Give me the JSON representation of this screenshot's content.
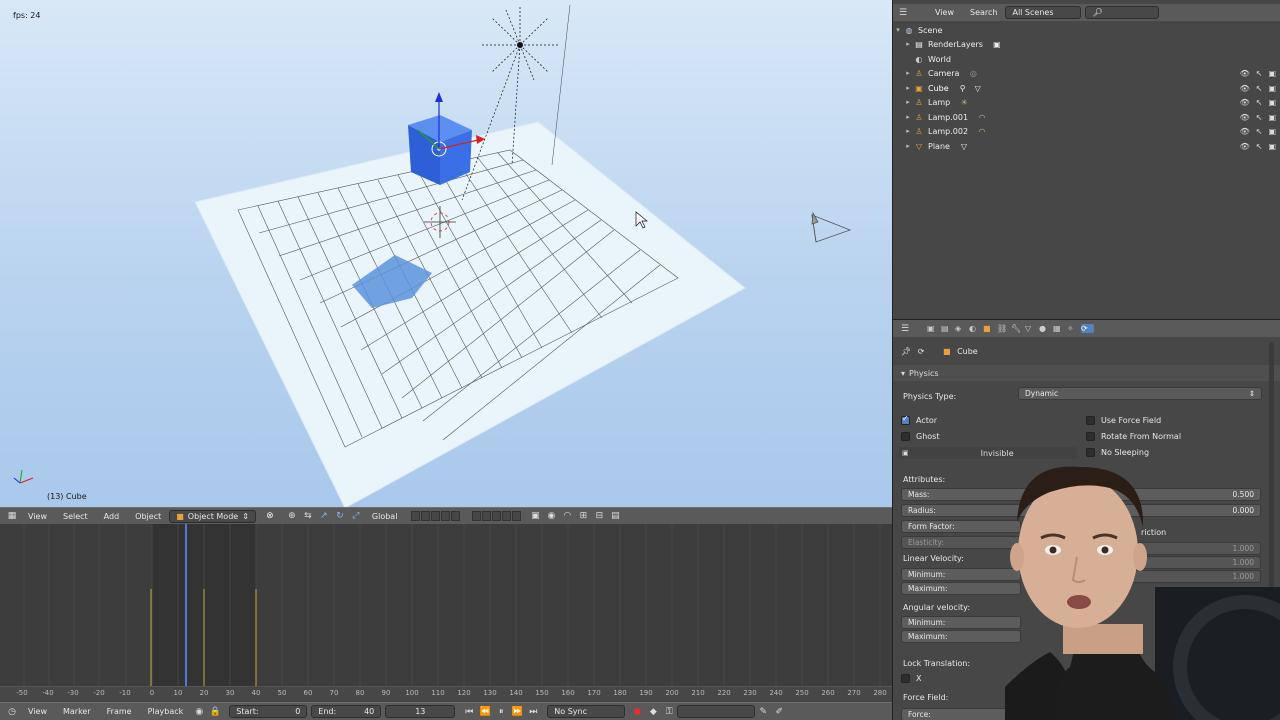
{
  "viewport": {
    "fps": "fps: 24",
    "object_label": "(13) Cube"
  },
  "view3d_header": {
    "menu_view": "View",
    "menu_select": "Select",
    "menu_add": "Add",
    "menu_object": "Object",
    "mode": "Object Mode",
    "orientation": "Global"
  },
  "timeline_header": {
    "menu_view": "View",
    "menu_marker": "Marker",
    "menu_frame": "Frame",
    "menu_playback": "Playback",
    "start_label": "Start:",
    "start_value": "0",
    "end_label": "End:",
    "end_value": "40",
    "current_frame": "13",
    "sync": "No Sync"
  },
  "ruler_ticks": [
    "-50",
    "-40",
    "-30",
    "-20",
    "-10",
    "0",
    "10",
    "20",
    "30",
    "40",
    "50",
    "60",
    "70",
    "80",
    "90",
    "100",
    "110",
    "120",
    "130",
    "140",
    "150",
    "160",
    "170",
    "180",
    "190",
    "200",
    "210",
    "220",
    "230",
    "240",
    "250",
    "260",
    "270",
    "280"
  ],
  "outliner": {
    "menu_view": "View",
    "menu_search": "Search",
    "scenes_dropdown": "All Scenes",
    "items": [
      {
        "label": "Scene",
        "indent": 0
      },
      {
        "label": "RenderLayers",
        "indent": 1
      },
      {
        "label": "World",
        "indent": 1
      },
      {
        "label": "Camera",
        "indent": 1
      },
      {
        "label": "Cube",
        "indent": 1
      },
      {
        "label": "Lamp",
        "indent": 1
      },
      {
        "label": "Lamp.001",
        "indent": 1
      },
      {
        "label": "Lamp.002",
        "indent": 1
      },
      {
        "label": "Plane",
        "indent": 1
      }
    ]
  },
  "properties": {
    "context_object": "Cube",
    "section_physics": "Physics",
    "physics_type_label": "Physics Type:",
    "physics_type_value": "Dynamic",
    "actor": "Actor",
    "ghost": "Ghost",
    "invisible": "Invisible",
    "use_force_field": "Use Force Field",
    "rotate_from_normal": "Rotate From Normal",
    "no_sleeping": "No Sleeping",
    "attributes": "Attributes:",
    "mass_label": "Mass:",
    "mass_value": "0.500",
    "radius_label": "Radius:",
    "radius_value": "0.000",
    "form_factor_label": "Form Factor:",
    "elasticity_label": "Elasticity:",
    "elasticity_value": "1.000",
    "friction_partial": "riction",
    "val_a": "1.000",
    "val_b": "1.000",
    "linear_velocity": "Linear Velocity:",
    "lin_min": "Minimum:",
    "lin_max": "Maximum:",
    "angular_velocity": "Angular velocity:",
    "ang_min": "Minimum:",
    "ang_max": "Maximum:",
    "lock_translation": "Lock Translation:",
    "lock_x": "X",
    "force_field": "Force Field:",
    "force": "Force:"
  }
}
